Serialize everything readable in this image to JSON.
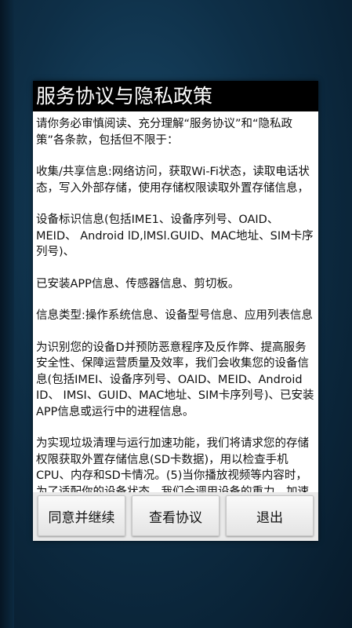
{
  "dialog": {
    "title": "服务协议与隐私政策",
    "paragraphs": [
      "请你务必审慎阅读、充分理解“服务协议”和“隐私政策”各条款，包括但不限于：",
      "收集/共享信息:网络访问，获取Wi-Fi状态，读取电话状态，写入外部存储，使用存储权限读取外置存储信息，",
      "设备标识信息(包括IME1、设备序列号、OAID、MEID、 Android lD,lMSl.GUID、MAC地址、SIM卡序列号)、",
      "已安装APP信息、传感器信息、剪切板。",
      "信息类型:操作系统信息、设备型号信息、应用列表信息",
      "为识别您的设备D并预防恶意程序及反作弊、提高服务安全性、保障运营质量及效率，我们会收集您的设备信息(包括IMEI、设备序列号、OAID、MEID、Android ID、 IMSI、GUID、MAC地址、SIM卡序列号)、已安装APP信息或运行中的进程信息。",
      "为实现垃圾清理与运行加速功能，我们将请求您的存储权限获取外置存储信息(SD卡数据)，用以检查手机CPU、内存和SD卡情况。(5)当你播放视频等内容时，为了适配你的设备状态，我们会调用设备的重力、加速度等传感器信息，以识别你的设备横竖屏状态。"
    ],
    "buttons": {
      "agree": "同意并继续",
      "view": "查看协议",
      "exit": "退出"
    }
  }
}
